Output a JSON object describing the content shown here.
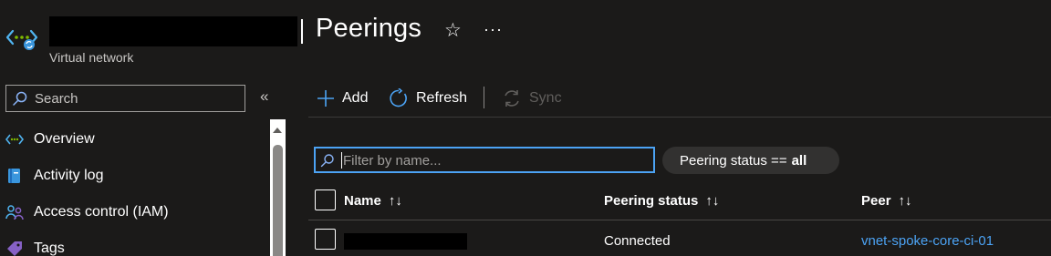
{
  "header": {
    "title": "Peerings",
    "subtitle": "Virtual network"
  },
  "sidebar": {
    "search_placeholder": "Search",
    "collapse_glyph": "«",
    "items": [
      {
        "label": "Overview",
        "icon": "vnet-icon"
      },
      {
        "label": "Activity log",
        "icon": "activity-log-icon"
      },
      {
        "label": "Access control (IAM)",
        "icon": "people-icon"
      },
      {
        "label": "Tags",
        "icon": "tag-icon"
      }
    ]
  },
  "toolbar": {
    "add_label": "Add",
    "refresh_label": "Refresh",
    "sync_label": "Sync"
  },
  "filter": {
    "placeholder": "Filter by name...",
    "status_pill_prefix": "Peering status ==",
    "status_pill_value": "all"
  },
  "table": {
    "columns": [
      "Name",
      "Peering status",
      "Peer"
    ],
    "rows": [
      {
        "name": "",
        "status": "Connected",
        "peer": "vnet-spoke-core-ci-01"
      }
    ]
  },
  "colors": {
    "background": "#1b1a19",
    "accent": "#4ca3f4",
    "text": "#ffffff",
    "muted": "#c8c6c4"
  }
}
